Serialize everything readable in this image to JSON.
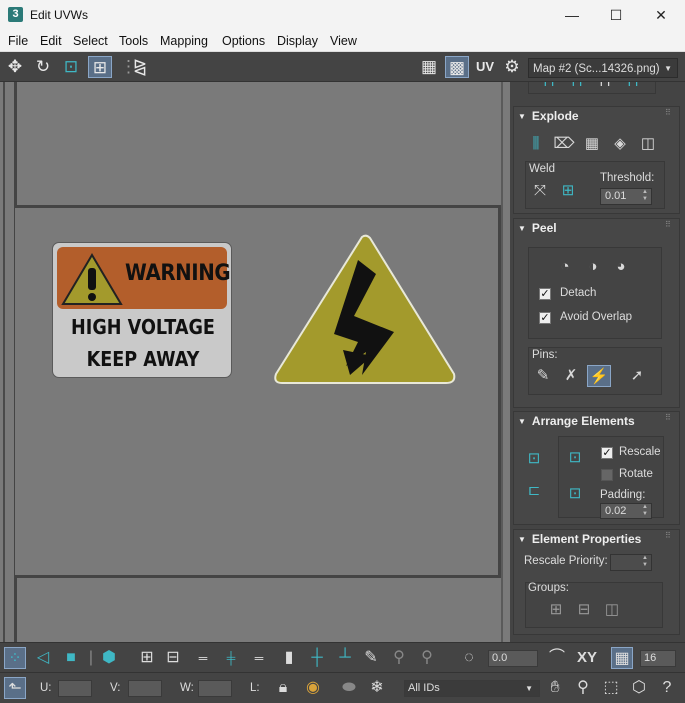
{
  "window": {
    "title": "Edit UVWs",
    "app_icon_glyph": "3",
    "controls": {
      "minimize": "—",
      "maximize": "☐",
      "close": "✕"
    }
  },
  "menu": [
    "File",
    "Edit",
    "Select",
    "Tools",
    "Mapping",
    "Options",
    "Display",
    "View"
  ],
  "toolbar": {
    "uv_label": "UV",
    "map_select": "Map #2 (Sc...14326.png)"
  },
  "viewport": {
    "warning_sign": {
      "header": "WARNING",
      "line1": "HIGH VOLTAGE",
      "line2": "KEEP AWAY"
    },
    "colors": {
      "banner": "#b35e2b",
      "triangle": "#a39a2c",
      "background": "#7a7a7a"
    }
  },
  "panel": {
    "explode": {
      "title": "Explode",
      "weld_label": "Weld",
      "threshold_label": "Threshold:",
      "threshold_value": "0.01"
    },
    "peel": {
      "title": "Peel",
      "detach_label": "Detach",
      "detach_checked": true,
      "avoid_overlap_label": "Avoid Overlap",
      "avoid_overlap_checked": true,
      "pins_label": "Pins:"
    },
    "arrange": {
      "title": "Arrange Elements",
      "rescale_label": "Rescale",
      "rescale_checked": true,
      "rotate_label": "Rotate",
      "rotate_checked": false,
      "padding_label": "Padding:",
      "padding_value": "0.02"
    },
    "element_properties": {
      "title": "Element Properties",
      "rescale_priority_label": "Rescale Priority:",
      "groups_label": "Groups:"
    }
  },
  "bottom": {
    "rotate_value": "0.0",
    "xy_label": "XY",
    "grid_value": "16",
    "u_label": "U:",
    "v_label": "V:",
    "w_label": "W:",
    "l_label": "L:",
    "ids_select": "All IDs"
  }
}
